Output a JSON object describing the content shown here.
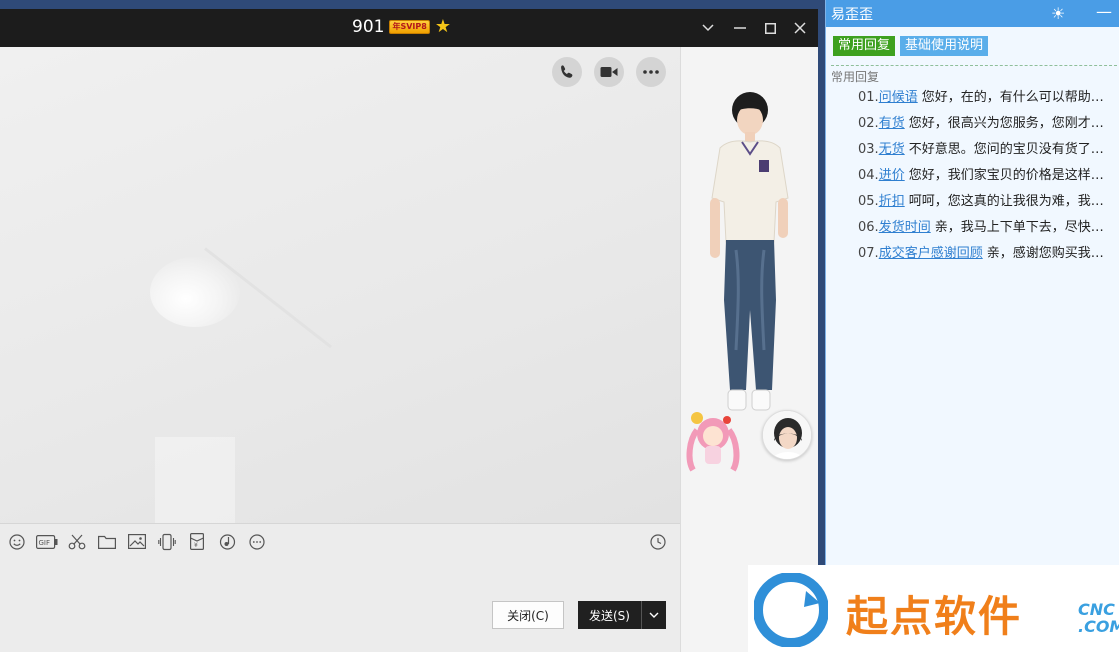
{
  "chat": {
    "title": "901",
    "vip_badge": "年SVIP8",
    "toolbar_icons": [
      "emoji-icon",
      "gif-icon",
      "scissors-icon",
      "folder-icon",
      "image-icon",
      "shake-icon",
      "red-packet-icon",
      "music-icon",
      "more-icon"
    ]
  },
  "buttons": {
    "close": "关闭(C)",
    "send": "发送(S)"
  },
  "reply_panel": {
    "title": "易歪歪",
    "tabs": [
      "常用回复",
      "基础使用说明"
    ],
    "section": "常用回复",
    "items": [
      {
        "num": "01.",
        "keyword": "问候语",
        "text": "您好，在的，有什么可以帮助您..."
      },
      {
        "num": "02.",
        "keyword": "有货",
        "text": "您好，很高兴为您服务，您刚才说..."
      },
      {
        "num": "03.",
        "keyword": "无货",
        "text": "不好意思。您问的宝贝没有货了，..."
      },
      {
        "num": "04.",
        "keyword": "进价",
        "text": "您好，我们家宝贝的价格是这样的..."
      },
      {
        "num": "05.",
        "keyword": "折扣",
        "text": "呵呵，您这真的让我很为难，我请..."
      },
      {
        "num": "06.",
        "keyword": "发货时间",
        "text": "亲，我马上下单下去，尽快给..."
      },
      {
        "num": "07.",
        "keyword": "成交客户感谢回顾",
        "text": "亲，感谢您购买我们..."
      }
    ]
  },
  "watermark": {
    "text": "起点软件",
    "suffix_top": "CNC",
    "suffix_bottom": ".COM"
  },
  "colors": {
    "accent": "#4a9de6",
    "active_tab": "#3ea11f",
    "link": "#2f7fd0",
    "titlebar": "#1c1c1c"
  }
}
